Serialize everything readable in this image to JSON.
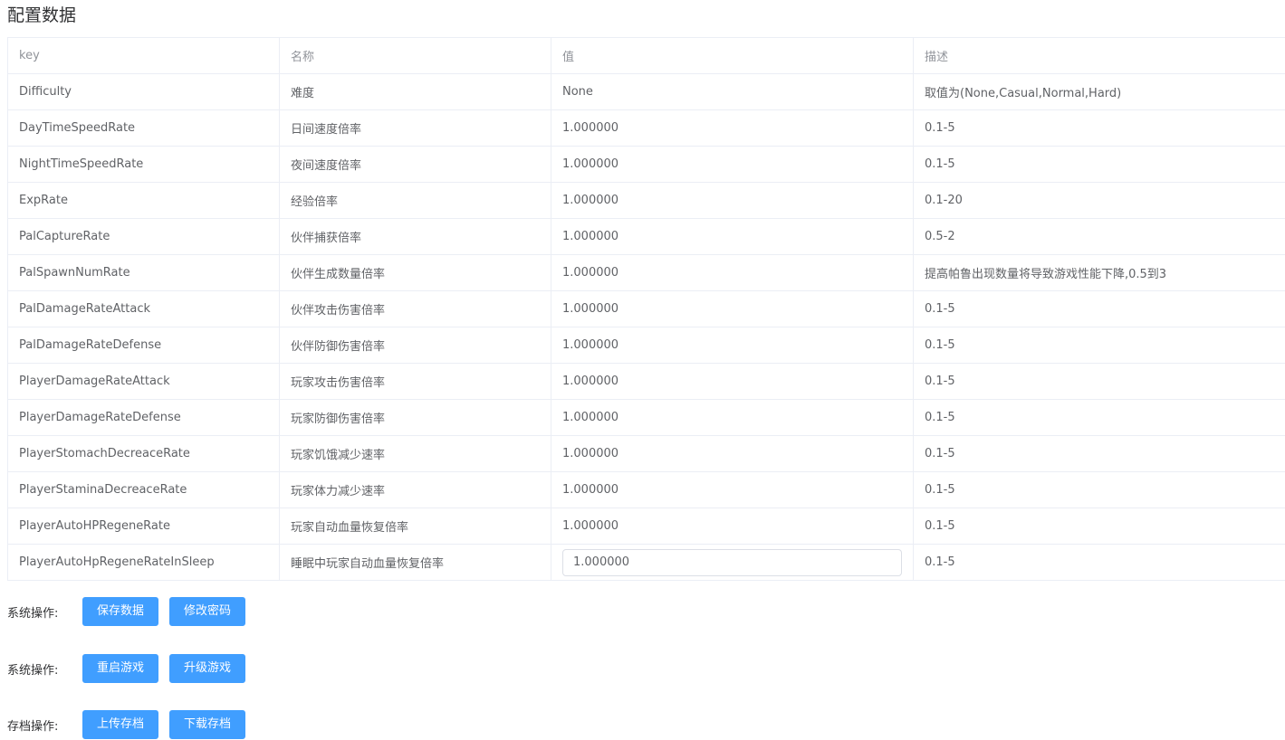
{
  "page": {
    "title": "配置数据"
  },
  "table": {
    "headers": [
      "key",
      "名称",
      "值",
      "描述"
    ],
    "rows": [
      {
        "key": "Difficulty",
        "name": "难度",
        "value": "None",
        "desc": "取值为(None,Casual,Normal,Hard)"
      },
      {
        "key": "DayTimeSpeedRate",
        "name": "日间速度倍率",
        "value": "1.000000",
        "desc": "0.1-5"
      },
      {
        "key": "NightTimeSpeedRate",
        "name": "夜间速度倍率",
        "value": "1.000000",
        "desc": "0.1-5"
      },
      {
        "key": "ExpRate",
        "name": "经验倍率",
        "value": "1.000000",
        "desc": "0.1-20"
      },
      {
        "key": "PalCaptureRate",
        "name": "伙伴捕获倍率",
        "value": "1.000000",
        "desc": "0.5-2"
      },
      {
        "key": "PalSpawnNumRate",
        "name": "伙伴生成数量倍率",
        "value": "1.000000",
        "desc": "提高帕鲁出现数量将导致游戏性能下降,0.5到3"
      },
      {
        "key": "PalDamageRateAttack",
        "name": "伙伴攻击伤害倍率",
        "value": "1.000000",
        "desc": "0.1-5"
      },
      {
        "key": "PalDamageRateDefense",
        "name": "伙伴防御伤害倍率",
        "value": "1.000000",
        "desc": "0.1-5"
      },
      {
        "key": "PlayerDamageRateAttack",
        "name": "玩家攻击伤害倍率",
        "value": "1.000000",
        "desc": "0.1-5"
      },
      {
        "key": "PlayerDamageRateDefense",
        "name": "玩家防御伤害倍率",
        "value": "1.000000",
        "desc": "0.1-5"
      },
      {
        "key": "PlayerStomachDecreaceRate",
        "name": "玩家饥饿减少速率",
        "value": "1.000000",
        "desc": "0.1-5"
      },
      {
        "key": "PlayerStaminaDecreaceRate",
        "name": "玩家体力减少速率",
        "value": "1.000000",
        "desc": "0.1-5"
      },
      {
        "key": "PlayerAutoHPRegeneRate",
        "name": "玩家自动血量恢复倍率",
        "value": "1.000000",
        "desc": "0.1-5"
      }
    ],
    "edit_row": {
      "key": "PlayerAutoHpRegeneRateInSleep",
      "name": "睡眠中玩家自动血量恢复倍率",
      "value": "1.000000",
      "desc": "0.1-5"
    }
  },
  "operations": [
    {
      "label": "系统操作:",
      "buttons": [
        "保存数据",
        "修改密码"
      ]
    },
    {
      "label": "系统操作:",
      "buttons": [
        "重启游戏",
        "升级游戏"
      ]
    },
    {
      "label": "存档操作:",
      "buttons": [
        "上传存档",
        "下载存档"
      ]
    }
  ],
  "colors": {
    "primary": "#409eff",
    "border": "#ebeef5",
    "header_text": "#909399",
    "cell_text": "#606266"
  }
}
